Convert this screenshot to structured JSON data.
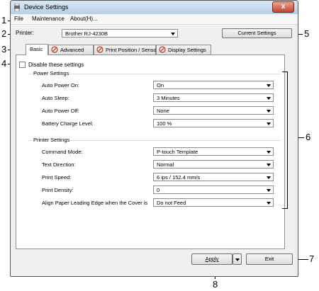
{
  "window": {
    "title": "Device Settings",
    "close_label": "x"
  },
  "menu": [
    "File",
    "Maintenance",
    "About(H)..."
  ],
  "printer": {
    "label": "Printer:",
    "value": "Brother RJ-4230B",
    "current_settings_label": "Current Settings"
  },
  "tabs": [
    {
      "label": "Basic",
      "active": true
    },
    {
      "label": "Advanced"
    },
    {
      "label": "Print Position / Sensor"
    },
    {
      "label": "Display Settings"
    }
  ],
  "disable_label": "Disable these settings",
  "power_settings": {
    "title": "Power Settings",
    "rows": [
      {
        "label": "Auto Power On:",
        "value": "On"
      },
      {
        "label": "Auto Sleep:",
        "value": "3 Minutes"
      },
      {
        "label": "Auto Power Off:",
        "value": "None"
      },
      {
        "label": "Battery Charge Level:",
        "value": "100 %"
      }
    ]
  },
  "printer_settings": {
    "title": "Printer Settings",
    "rows": [
      {
        "label": "Command Mode:",
        "value": "P-touch Template"
      },
      {
        "label": "Text Direction:",
        "value": "Normal"
      },
      {
        "label": "Print Speed:",
        "value": "6 ips / 152.4 mm/s"
      },
      {
        "label": "Print Density:",
        "value": "0"
      },
      {
        "label": "Align Paper Leading Edge when the Cover is",
        "value": "Do not Feed"
      }
    ]
  },
  "buttons": {
    "apply": "Apply",
    "exit": "Exit"
  },
  "callouts": {
    "c1": "1",
    "c2": "2",
    "c3": "3",
    "c4": "4",
    "c5": "5",
    "c6": "6",
    "c7": "7",
    "c8": "8"
  },
  "colors": {
    "title_bar": "#c9dbee",
    "close_button": "#c4432b",
    "panel_bg": "#ffffff",
    "window_bg": "#f0f0f0"
  }
}
